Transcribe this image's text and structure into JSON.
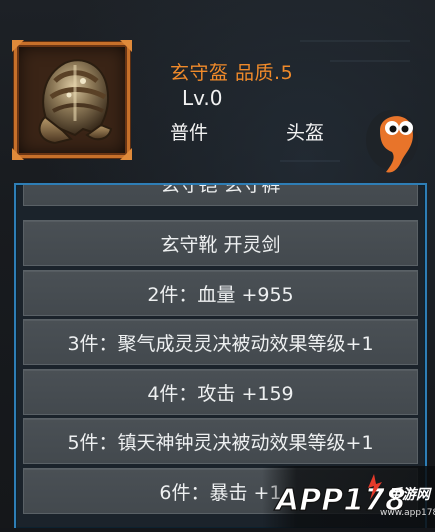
{
  "item": {
    "name_quality": "玄守盔 品质.5",
    "level": "Lv.0",
    "type": "普件",
    "slot": "头盔",
    "icon": "helmet-icon"
  },
  "mascot": {
    "icon": "orange-mascot-icon"
  },
  "set_panel": {
    "rows": [
      "玄守铠  玄守裤",
      "玄守靴  开灵剑",
      "2件：血量 +955",
      "3件：聚气成灵灵决被动效果等级+1",
      "4件：攻击 +159",
      "5件：镇天神钟灵决被动效果等级+1",
      "6件：暴击 +1"
    ]
  },
  "watermark": {
    "text": "APP178手游网",
    "subtext": "www.app178.com"
  },
  "colors": {
    "quality_orange": "#f08a2a",
    "frame_orange": "#c7702a",
    "panel_border_blue": "#2e7eb6",
    "row_gray": "#474d52",
    "text_white": "#eef0f1"
  }
}
